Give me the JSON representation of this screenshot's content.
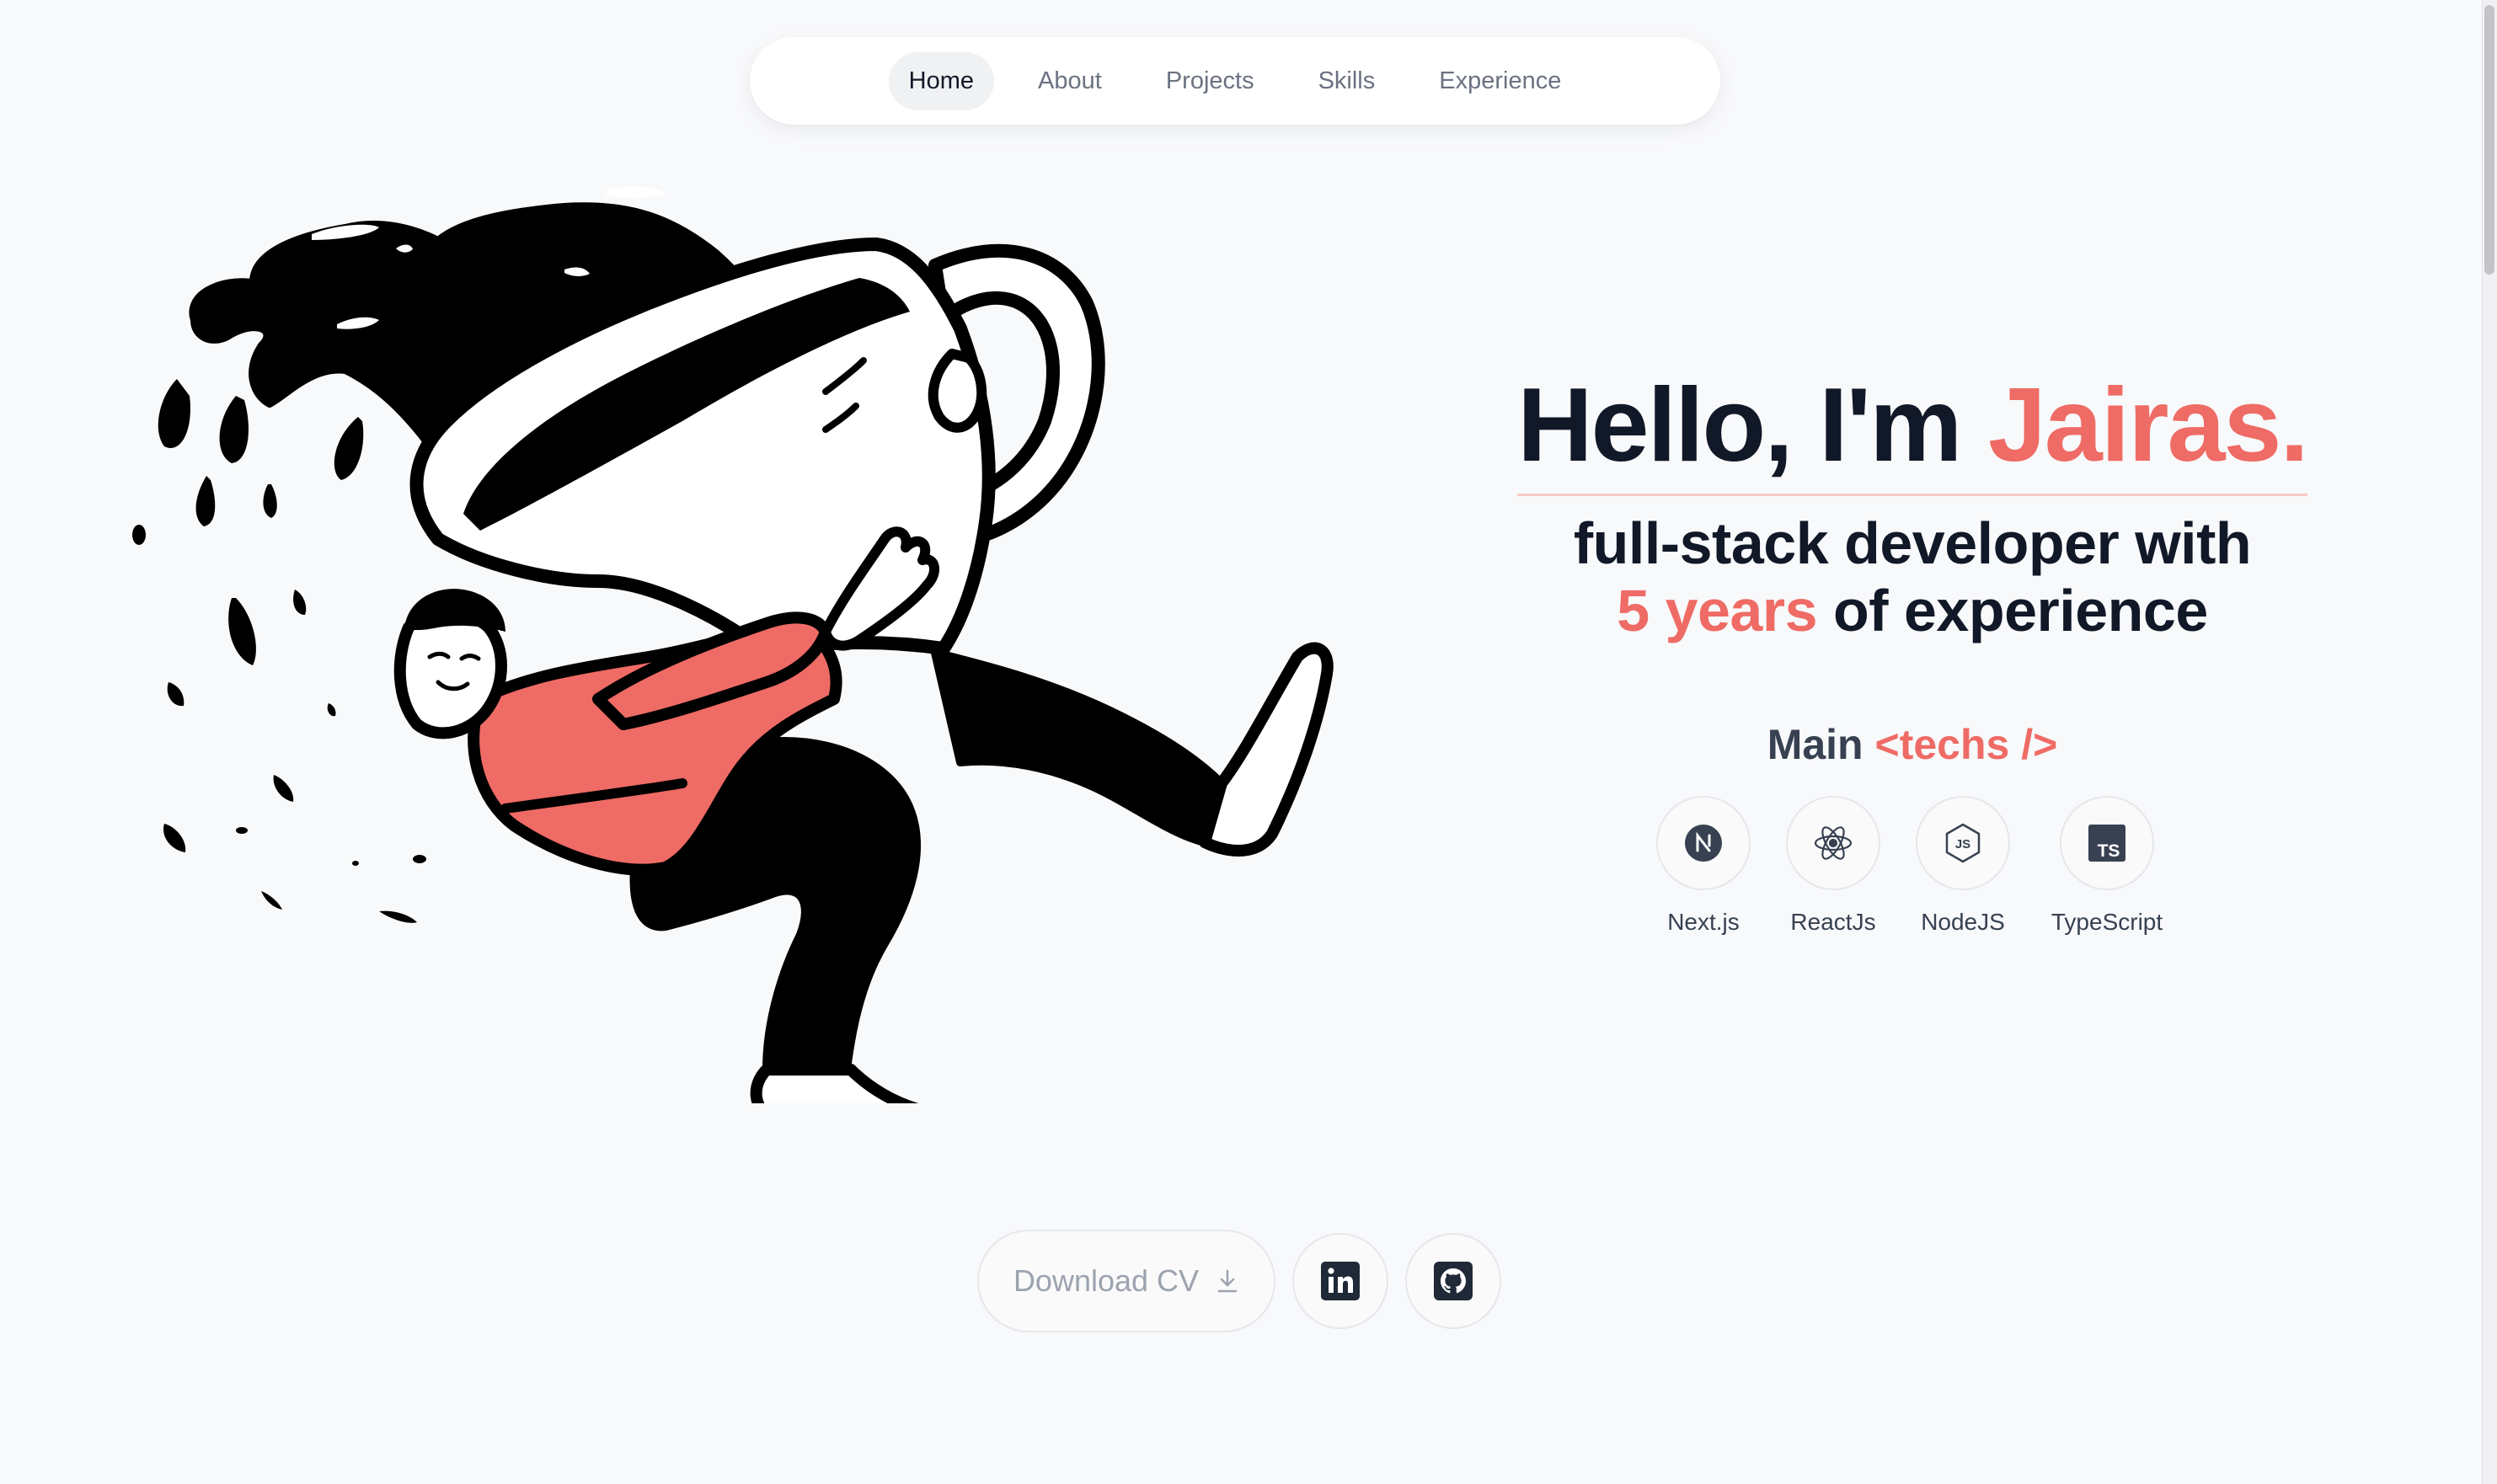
{
  "nav": {
    "items": [
      {
        "label": "Home",
        "active": true
      },
      {
        "label": "About",
        "active": false
      },
      {
        "label": "Projects",
        "active": false
      },
      {
        "label": "Skills",
        "active": false
      },
      {
        "label": "Experience",
        "active": false
      }
    ]
  },
  "hero": {
    "greeting": "Hello, I'm ",
    "name": "Jairas.",
    "subtitle_line1": "full-stack developer with",
    "years": "5 years",
    "subtitle_line2_rest": " of experience"
  },
  "techs": {
    "heading_main": "Main ",
    "heading_accent": "<techs />",
    "items": [
      {
        "label": "Next.js",
        "icon": "nextjs-icon"
      },
      {
        "label": "ReactJs",
        "icon": "react-icon"
      },
      {
        "label": "NodeJS",
        "icon": "nodejs-icon"
      },
      {
        "label": "TypeScript",
        "icon": "typescript-icon"
      }
    ]
  },
  "actions": {
    "download_cv_label": "Download CV",
    "download_icon": "download-icon",
    "linkedin_icon": "linkedin-icon",
    "github_icon": "github-icon"
  },
  "colors": {
    "accent": "#ef6b65",
    "text_dark": "#111827",
    "background": "#f8f9fb"
  }
}
